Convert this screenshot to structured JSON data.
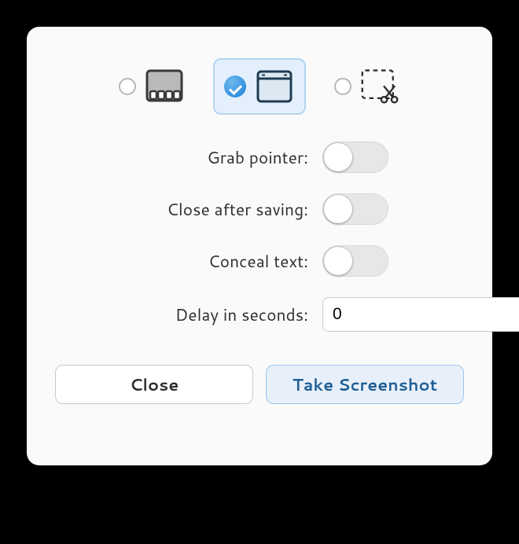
{
  "modes": {
    "screen": {
      "selected": false
    },
    "window": {
      "selected": true
    },
    "selection": {
      "selected": false
    }
  },
  "options": {
    "grab_pointer": {
      "label": "Grab pointer:",
      "value": false
    },
    "close_after_saving": {
      "label": "Close after saving:",
      "value": false
    },
    "conceal_text": {
      "label": "Conceal text:",
      "value": false
    },
    "delay": {
      "label": "Delay in seconds:",
      "value": "0"
    }
  },
  "buttons": {
    "close": "Close",
    "take": "Take Screenshot"
  },
  "glyphs": {
    "minus": "−",
    "plus": "+"
  }
}
